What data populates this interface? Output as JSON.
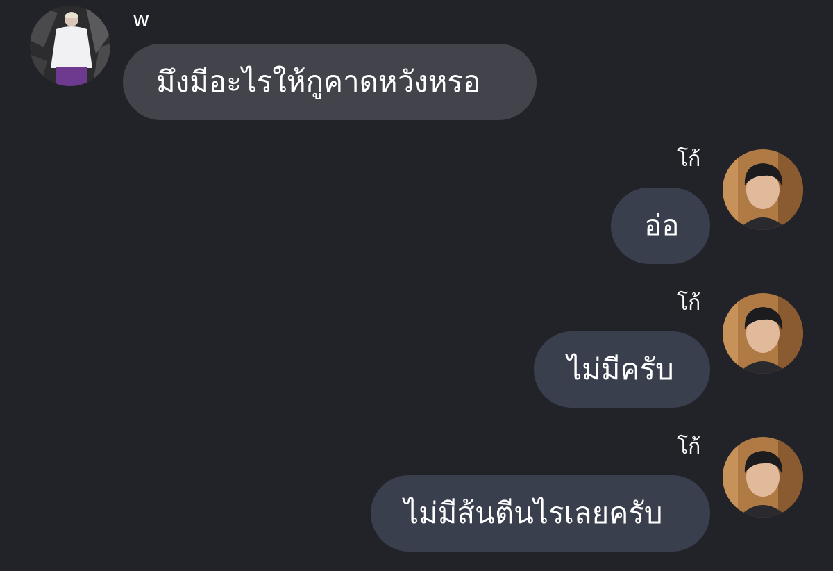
{
  "conversation": {
    "messages": [
      {
        "sender": "w",
        "text": "มึงมีอะไรให้กูคาดหวังหรอ",
        "side": "left"
      },
      {
        "sender": "โก้",
        "text": "อ่อ",
        "side": "right"
      },
      {
        "sender": "โก้",
        "text": "ไม่มีครับ",
        "side": "right"
      },
      {
        "sender": "โก้",
        "text": "ไม่มีส้นตีนไรเลยครับ",
        "side": "right"
      }
    ]
  },
  "colors": {
    "background": "#222329",
    "incoming_bubble": "#43444b",
    "outgoing_bubble": "#3a3f4e",
    "text": "#ffffff"
  }
}
